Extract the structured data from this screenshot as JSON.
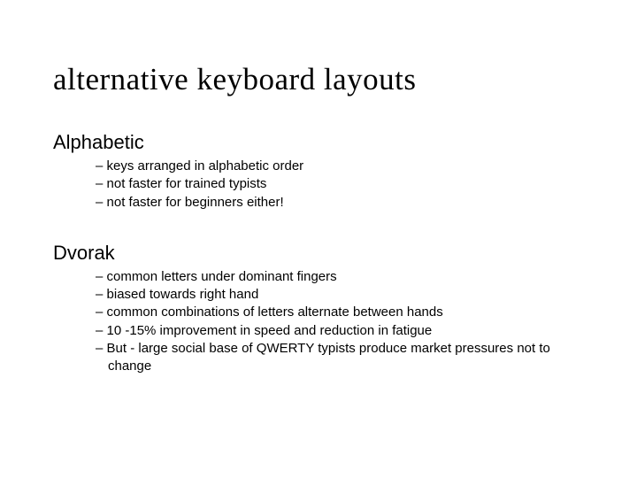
{
  "title": "alternative keyboard layouts",
  "sections": [
    {
      "heading": "Alphabetic",
      "items": [
        "keys arranged in alphabetic order",
        "not faster for trained typists",
        "not faster for beginners either!"
      ]
    },
    {
      "heading": "Dvorak",
      "items": [
        "common letters under dominant fingers",
        "biased towards right hand",
        "common combinations of letters alternate between hands",
        "10 -15% improvement in speed and reduction in fatigue",
        "But - large social base of QWERTY typists produce market pressures not to change"
      ]
    }
  ]
}
